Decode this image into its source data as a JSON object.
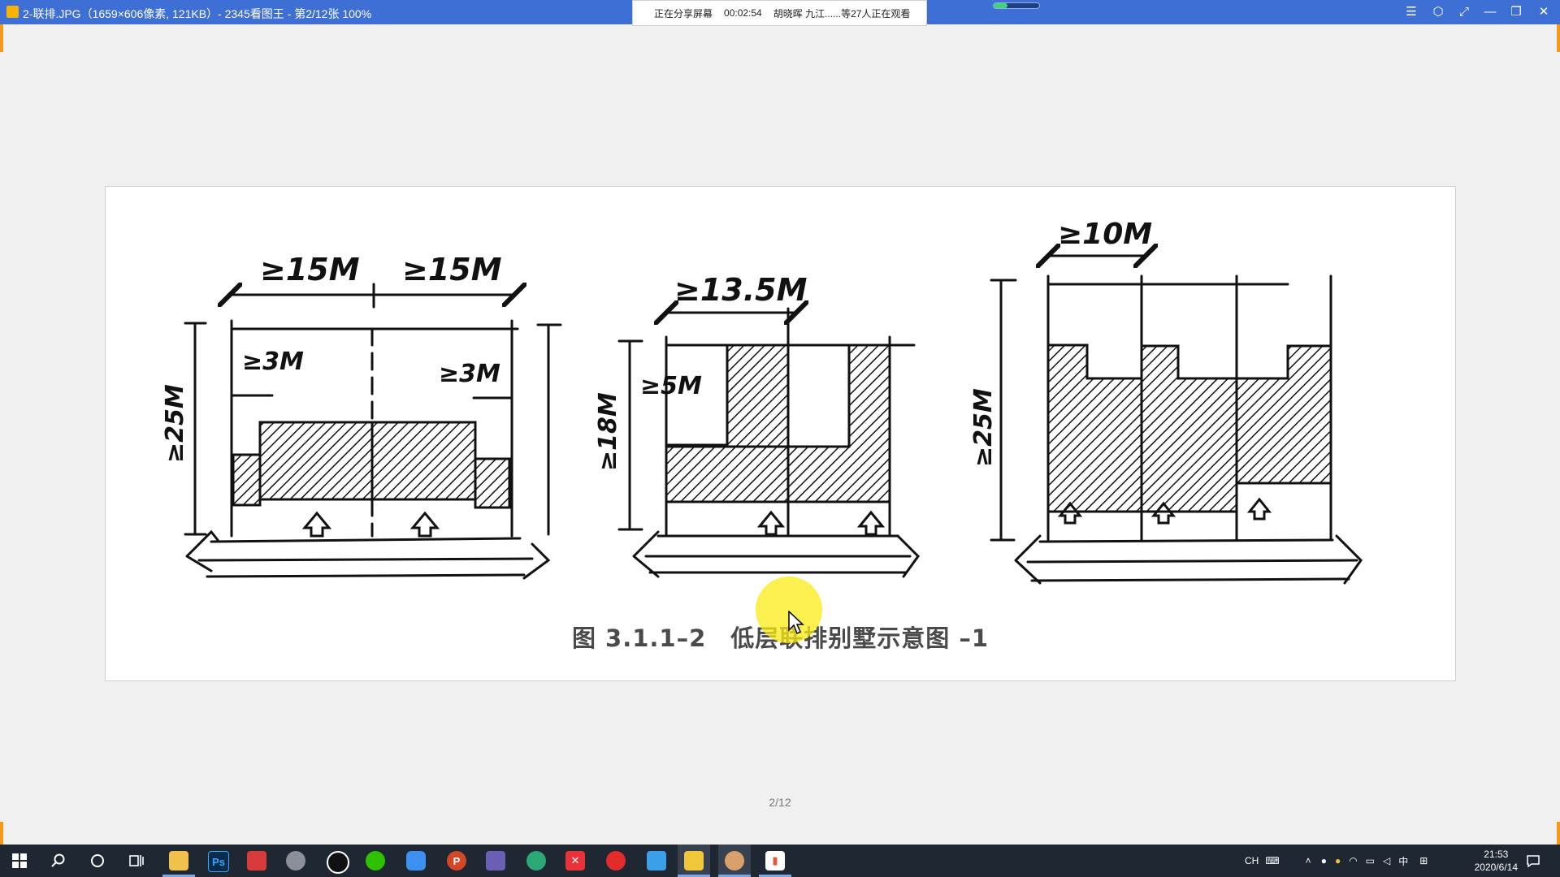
{
  "window": {
    "title": "2-联排.JPG（1659×606像素, 121KB）- 2345看图王 - 第2/12张 100%",
    "controls": [
      "☰",
      "⬡",
      "⤢",
      "—",
      "❐",
      "✕"
    ]
  },
  "share_bar": {
    "status": "正在分享屏幕",
    "timer": "00:02:54",
    "viewers": "胡晓晖 九江......等27人正在观看"
  },
  "image": {
    "caption": "图 3.1.1–2　低层联排别墅示意图 –1",
    "dimension_labels": {
      "fig1_left_width": "≥15M",
      "fig1_right_width": "≥15M",
      "fig1_left_setback": "≥3M",
      "fig1_right_setback": "≥3M",
      "fig1_depth": "≥25M",
      "fig2_width": "≥13.5M",
      "fig2_setback": "≥5M",
      "fig2_depth": "≥18M",
      "fig3_width": "≥10M",
      "fig3_depth": "≥25M"
    }
  },
  "viewer": {
    "page_indicator": "2/12"
  },
  "taskbar": {
    "tray": {
      "lang_en": "CH",
      "ime": "中",
      "clock_time": "21:53",
      "clock_date": "2020/6/14"
    }
  },
  "colors": {
    "titlebar": "#3d6fd4",
    "taskbar": "#1f2733",
    "accent_orange": "#f39a1b"
  }
}
